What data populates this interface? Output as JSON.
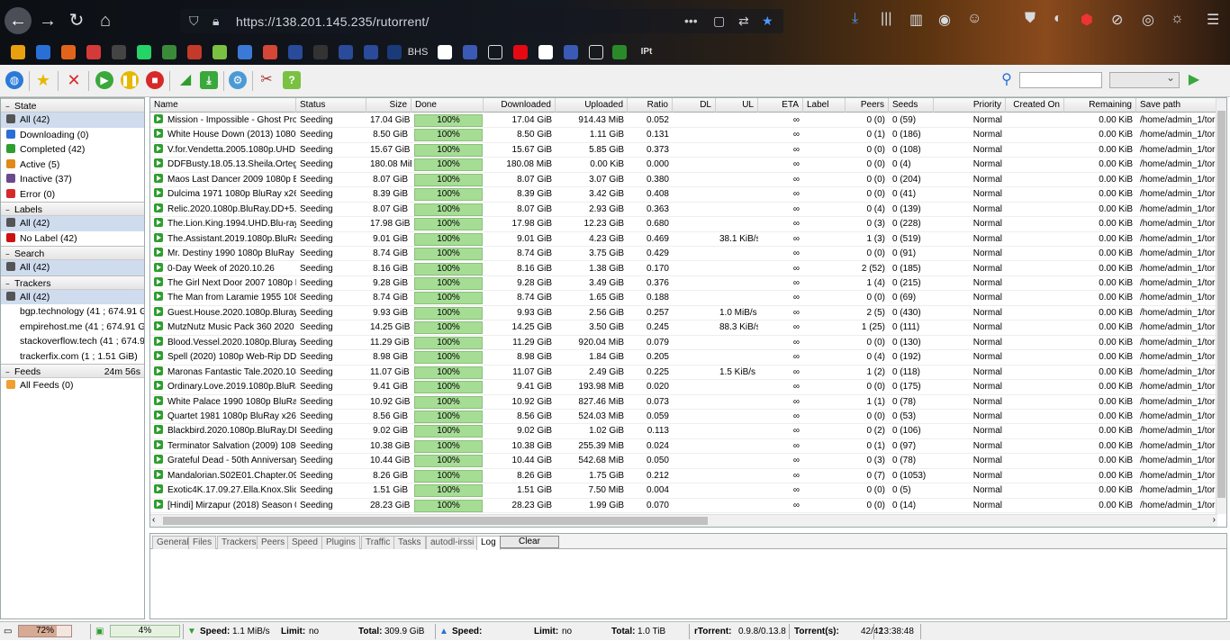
{
  "browser": {
    "url": "https://138.201.145.235/rutorrent/",
    "bookmarks": [
      "",
      "",
      "",
      "",
      "",
      "",
      "",
      "",
      "",
      "",
      "",
      "BHS",
      "",
      "",
      "",
      "",
      "",
      "",
      "",
      "",
      "",
      "",
      "",
      "IPt"
    ]
  },
  "sidebar": {
    "state": {
      "title": "State",
      "items": [
        {
          "label": "All (42)",
          "color": "#555555",
          "selected": true
        },
        {
          "label": "Downloading (0)",
          "color": "#2a6fd6"
        },
        {
          "label": "Completed (42)",
          "color": "#2e9e2e"
        },
        {
          "label": "Active (5)",
          "color": "#e08a1a"
        },
        {
          "label": "Inactive (37)",
          "color": "#6a4a8a"
        },
        {
          "label": "Error (0)",
          "color": "#d62a2a"
        }
      ]
    },
    "labels": {
      "title": "Labels",
      "items": [
        {
          "label": "All (42)",
          "color": "#555555",
          "selected": true
        },
        {
          "label": "No Label (42)",
          "color": "#cc1111"
        }
      ]
    },
    "search": {
      "title": "Search",
      "items": [
        {
          "label": "All (42)",
          "color": "#555555",
          "selected": true
        }
      ]
    },
    "trackers": {
      "title": "Trackers",
      "items": [
        {
          "label": "All (42)",
          "color": "#555555",
          "selected": true
        },
        {
          "label": "bgp.technology (41 ; 674.91 GiB)"
        },
        {
          "label": "empirehost.me (41 ; 674.91 GiB)"
        },
        {
          "label": "stackoverflow.tech (41 ; 674.91 GiB)"
        },
        {
          "label": "trackerfix.com (1 ; 1.51 GiB)"
        }
      ]
    },
    "feeds": {
      "title": "Feeds",
      "time": "24m 56s",
      "items": [
        {
          "label": "All Feeds (0)",
          "color": "#f0a030"
        }
      ]
    }
  },
  "grid": {
    "columns": [
      "Name",
      "Status",
      "Size",
      "Done",
      "Downloaded",
      "Uploaded",
      "Ratio",
      "DL",
      "UL",
      "ETA",
      "Label",
      "Peers",
      "Seeds",
      "Priority",
      "Created On",
      "Remaining",
      "Save path"
    ],
    "rows": [
      [
        "Mission - Impossible - Ghost Protocol",
        "Seeding",
        "17.04 GiB",
        "100%",
        "17.04 GiB",
        "914.43 MiB",
        "0.052",
        "",
        "",
        "∞",
        "",
        "0 (0)",
        "0 (59)",
        "Normal",
        "",
        "0.00 KiB",
        "/home/admin_1/torrents"
      ],
      [
        "White House Down (2013) 1080p A",
        "Seeding",
        "8.50 GiB",
        "100%",
        "8.50 GiB",
        "1.11 GiB",
        "0.131",
        "",
        "",
        "∞",
        "",
        "0 (1)",
        "0 (186)",
        "Normal",
        "",
        "0.00 KiB",
        "/home/admin_1/torrents"
      ],
      [
        "V.for.Vendetta.2005.1080p.UHD.BluRay",
        "Seeding",
        "15.67 GiB",
        "100%",
        "15.67 GiB",
        "5.85 GiB",
        "0.373",
        "",
        "",
        "∞",
        "",
        "0 (0)",
        "0 (108)",
        "Normal",
        "",
        "0.00 KiB",
        "/home/admin_1/torrents"
      ],
      [
        "DDFBusty.18.05.13.Sheila.Ortega.XXX",
        "Seeding",
        "180.08 MiB",
        "100%",
        "180.08 MiB",
        "0.00 KiB",
        "0.000",
        "",
        "",
        "∞",
        "",
        "0 (0)",
        "0 (4)",
        "Normal",
        "",
        "0.00 KiB",
        "/home/admin_1/torrents"
      ],
      [
        "Maos Last Dancer 2009 1080p BluRay",
        "Seeding",
        "8.07 GiB",
        "100%",
        "8.07 GiB",
        "3.07 GiB",
        "0.380",
        "",
        "",
        "∞",
        "",
        "0 (0)",
        "0 (204)",
        "Normal",
        "",
        "0.00 KiB",
        "/home/admin_1/torrents"
      ],
      [
        "Dulcima 1971 1080p BluRay x264-HANDJOB",
        "Seeding",
        "8.39 GiB",
        "100%",
        "8.39 GiB",
        "3.42 GiB",
        "0.408",
        "",
        "",
        "∞",
        "",
        "0 (0)",
        "0 (41)",
        "Normal",
        "",
        "0.00 KiB",
        "/home/admin_1/torrents"
      ],
      [
        "Relic.2020.1080p.BluRay.DD+5.1.x264",
        "Seeding",
        "8.07 GiB",
        "100%",
        "8.07 GiB",
        "2.93 GiB",
        "0.363",
        "",
        "",
        "∞",
        "",
        "0 (4)",
        "0 (139)",
        "Normal",
        "",
        "0.00 KiB",
        "/home/admin_1/torrents"
      ],
      [
        "The.Lion.King.1994.UHD.Blu-ray.2160p",
        "Seeding",
        "17.98 GiB",
        "100%",
        "17.98 GiB",
        "12.23 GiB",
        "0.680",
        "",
        "",
        "∞",
        "",
        "0 (3)",
        "0 (228)",
        "Normal",
        "",
        "0.00 KiB",
        "/home/admin_1/torrents"
      ],
      [
        "The.Assistant.2019.1080p.BluRay.DD",
        "Seeding",
        "9.01 GiB",
        "100%",
        "9.01 GiB",
        "4.23 GiB",
        "0.469",
        "",
        "38.1 KiB/s",
        "∞",
        "",
        "1 (3)",
        "0 (519)",
        "Normal",
        "",
        "0.00 KiB",
        "/home/admin_1/torrents"
      ],
      [
        "Mr. Destiny 1990 1080p BluRay x264",
        "Seeding",
        "8.74 GiB",
        "100%",
        "8.74 GiB",
        "3.75 GiB",
        "0.429",
        "",
        "",
        "∞",
        "",
        "0 (0)",
        "0 (91)",
        "Normal",
        "",
        "0.00 KiB",
        "/home/admin_1/torrents"
      ],
      [
        "0-Day Week of 2020.10.26",
        "Seeding",
        "8.16 GiB",
        "100%",
        "8.16 GiB",
        "1.38 GiB",
        "0.170",
        "",
        "",
        "∞",
        "",
        "2 (52)",
        "0 (185)",
        "Normal",
        "",
        "0.00 KiB",
        "/home/admin_1/torrents"
      ],
      [
        "The Girl Next Door 2007 1080p BluRay",
        "Seeding",
        "9.28 GiB",
        "100%",
        "9.28 GiB",
        "3.49 GiB",
        "0.376",
        "",
        "",
        "∞",
        "",
        "1 (4)",
        "0 (215)",
        "Normal",
        "",
        "0.00 KiB",
        "/home/admin_1/torrents"
      ],
      [
        "The Man from Laramie 1955 1080p",
        "Seeding",
        "8.74 GiB",
        "100%",
        "8.74 GiB",
        "1.65 GiB",
        "0.188",
        "",
        "",
        "∞",
        "",
        "0 (0)",
        "0 (69)",
        "Normal",
        "",
        "0.00 KiB",
        "/home/admin_1/torrents"
      ],
      [
        "Guest.House.2020.1080p.Bluray.DTS",
        "Seeding",
        "9.93 GiB",
        "100%",
        "9.93 GiB",
        "2.56 GiB",
        "0.257",
        "",
        "1.0 MiB/s",
        "∞",
        "",
        "2 (5)",
        "0 (430)",
        "Normal",
        "",
        "0.00 KiB",
        "/home/admin_1/torrents"
      ],
      [
        "MutzNutz Music Pack 360 2020",
        "Seeding",
        "14.25 GiB",
        "100%",
        "14.25 GiB",
        "3.50 GiB",
        "0.245",
        "",
        "88.3 KiB/s",
        "∞",
        "",
        "1 (25)",
        "0 (111)",
        "Normal",
        "",
        "0.00 KiB",
        "/home/admin_1/torrents"
      ],
      [
        "Blood.Vessel.2020.1080p.Bluray.DTS",
        "Seeding",
        "11.29 GiB",
        "100%",
        "11.29 GiB",
        "920.04 MiB",
        "0.079",
        "",
        "",
        "∞",
        "",
        "0 (0)",
        "0 (130)",
        "Normal",
        "",
        "0.00 KiB",
        "/home/admin_1/torrents"
      ],
      [
        "Spell (2020) 1080p Web-Rip DD 5.1",
        "Seeding",
        "8.98 GiB",
        "100%",
        "8.98 GiB",
        "1.84 GiB",
        "0.205",
        "",
        "",
        "∞",
        "",
        "0 (4)",
        "0 (192)",
        "Normal",
        "",
        "0.00 KiB",
        "/home/admin_1/torrents"
      ],
      [
        "Maronas Fantastic Tale.2020.1080p",
        "Seeding",
        "11.07 GiB",
        "100%",
        "11.07 GiB",
        "2.49 GiB",
        "0.225",
        "",
        "1.5 KiB/s",
        "∞",
        "",
        "1 (2)",
        "0 (118)",
        "Normal",
        "",
        "0.00 KiB",
        "/home/admin_1/torrents"
      ],
      [
        "Ordinary.Love.2019.1080p.BluRay.DD",
        "Seeding",
        "9.41 GiB",
        "100%",
        "9.41 GiB",
        "193.98 MiB",
        "0.020",
        "",
        "",
        "∞",
        "",
        "0 (0)",
        "0 (175)",
        "Normal",
        "",
        "0.00 KiB",
        "/home/admin_1/torrents"
      ],
      [
        "White Palace 1990 1080p BluRay x264",
        "Seeding",
        "10.92 GiB",
        "100%",
        "10.92 GiB",
        "827.46 MiB",
        "0.073",
        "",
        "",
        "∞",
        "",
        "1 (1)",
        "0 (78)",
        "Normal",
        "",
        "0.00 KiB",
        "/home/admin_1/torrents"
      ],
      [
        "Quartet 1981 1080p BluRay x264 FLAC",
        "Seeding",
        "8.56 GiB",
        "100%",
        "8.56 GiB",
        "524.03 MiB",
        "0.059",
        "",
        "",
        "∞",
        "",
        "0 (0)",
        "0 (53)",
        "Normal",
        "",
        "0.00 KiB",
        "/home/admin_1/torrents"
      ],
      [
        "Blackbird.2020.1080p.BluRay.DD+5.1",
        "Seeding",
        "9.02 GiB",
        "100%",
        "9.02 GiB",
        "1.02 GiB",
        "0.113",
        "",
        "",
        "∞",
        "",
        "0 (2)",
        "0 (106)",
        "Normal",
        "",
        "0.00 KiB",
        "/home/admin_1/torrents"
      ],
      [
        "Terminator Salvation (2009) 1080p",
        "Seeding",
        "10.38 GiB",
        "100%",
        "10.38 GiB",
        "255.39 MiB",
        "0.024",
        "",
        "",
        "∞",
        "",
        "0 (1)",
        "0 (97)",
        "Normal",
        "",
        "0.00 KiB",
        "/home/admin_1/torrents"
      ],
      [
        "Grateful Dead - 50th Anniversary Mix",
        "Seeding",
        "10.44 GiB",
        "100%",
        "10.44 GiB",
        "542.68 MiB",
        "0.050",
        "",
        "",
        "∞",
        "",
        "0 (3)",
        "0 (78)",
        "Normal",
        "",
        "0.00 KiB",
        "/home/admin_1/torrents"
      ],
      [
        "Mandalorian.S02E01.Chapter.09.2160p",
        "Seeding",
        "8.26 GiB",
        "100%",
        "8.26 GiB",
        "1.75 GiB",
        "0.212",
        "",
        "",
        "∞",
        "",
        "0 (7)",
        "0 (1053)",
        "Normal",
        "",
        "0.00 KiB",
        "/home/admin_1/torrents"
      ],
      [
        "Exotic4K.17.09.27.Ella.Knox.Slick.Cum",
        "Seeding",
        "1.51 GiB",
        "100%",
        "1.51 GiB",
        "7.50 MiB",
        "0.004",
        "",
        "",
        "∞",
        "",
        "0 (0)",
        "0 (5)",
        "Normal",
        "",
        "0.00 KiB",
        "/home/admin_1/torrents"
      ],
      [
        "[Hindi] Mirzapur (2018) Season 01 1080p",
        "Seeding",
        "28.23 GiB",
        "100%",
        "28.23 GiB",
        "1.99 GiB",
        "0.070",
        "",
        "",
        "∞",
        "",
        "0 (0)",
        "0 (14)",
        "Normal",
        "",
        "0.00 KiB",
        "/home/admin_1/torrents"
      ]
    ]
  },
  "tabs": [
    "General",
    "Files",
    "Trackers",
    "Peers",
    "Speed",
    "Plugins",
    "Traffic",
    "Tasks",
    "autodl-irssi",
    "Log"
  ],
  "tabs_active": "Log",
  "clear_label": "Clear",
  "status": {
    "cpu": "72%",
    "cpu_fraction": 0.72,
    "mem": "4%",
    "dl_speed_label": "Speed:",
    "dl_speed": "1.1 MiB/s",
    "dl_limit_label": "Limit:",
    "dl_limit": "no",
    "dl_total_label": "Total:",
    "dl_total": "309.9 GiB",
    "ul_speed_label": "Speed:",
    "ul_limit_label": "Limit:",
    "ul_limit": "no",
    "ul_total_label": "Total:",
    "ul_total": "1.0 TiB",
    "rtorrent_label": "rTorrent:",
    "rtorrent_version": "0.9.8/0.13.8",
    "torrents_label": "Torrent(s):",
    "torrents_count": "42/42",
    "time": "13:38:48"
  }
}
